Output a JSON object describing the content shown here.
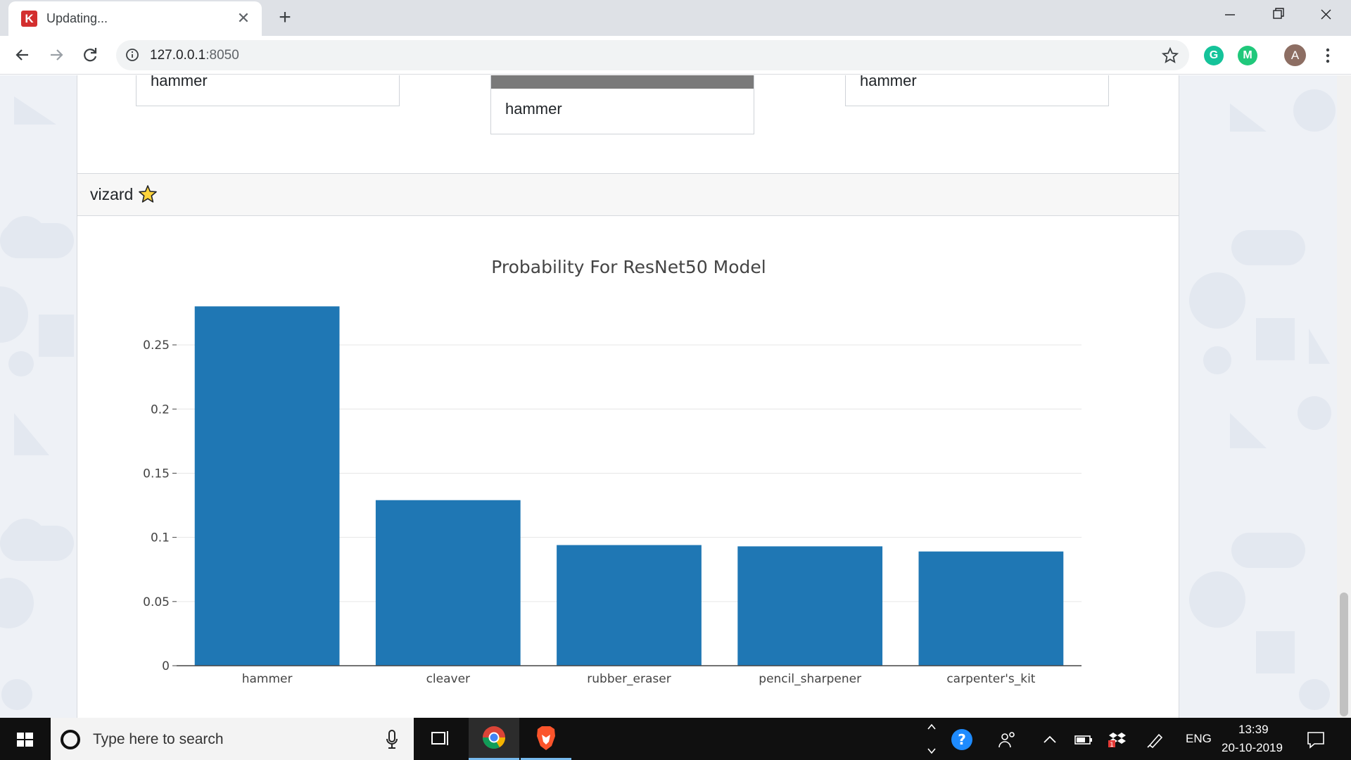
{
  "browser": {
    "tab_title": "Updating...",
    "tab_favicon_letter": "K",
    "url_host": "127.0.0.1",
    "url_port": ":8050",
    "profile_initial": "A",
    "extensions": [
      {
        "name": "grammarly-icon",
        "letter": "G"
      },
      {
        "name": "mercury-icon",
        "letter": "M"
      }
    ]
  },
  "top_card": {
    "captions": [
      "hammer",
      "hammer",
      "hammer"
    ]
  },
  "vizard_card": {
    "title": "vizard"
  },
  "chart_data": {
    "type": "bar",
    "title": "Probability For ResNet50 Model",
    "categories": [
      "hammer",
      "cleaver",
      "rubber_eraser",
      "pencil_sharpener",
      "carpenter's_kit"
    ],
    "values": [
      0.28,
      0.129,
      0.094,
      0.093,
      0.089
    ],
    "yticks": [
      0,
      0.05,
      0.1,
      0.15,
      0.2,
      0.25
    ],
    "ytick_labels": [
      "0",
      "0.05",
      "0.1",
      "0.15",
      "0.2",
      "0.25"
    ],
    "ylim": [
      0,
      0.295
    ],
    "grid": true,
    "bar_color": "#1f77b4",
    "xlabel": "",
    "ylabel": ""
  },
  "taskbar": {
    "search_placeholder": "Type here to search",
    "language": "ENG",
    "time": "13:39",
    "date": "20-10-2019"
  },
  "colors": {
    "accent": "#1f77b4",
    "page_bg": "#eef1f6"
  }
}
